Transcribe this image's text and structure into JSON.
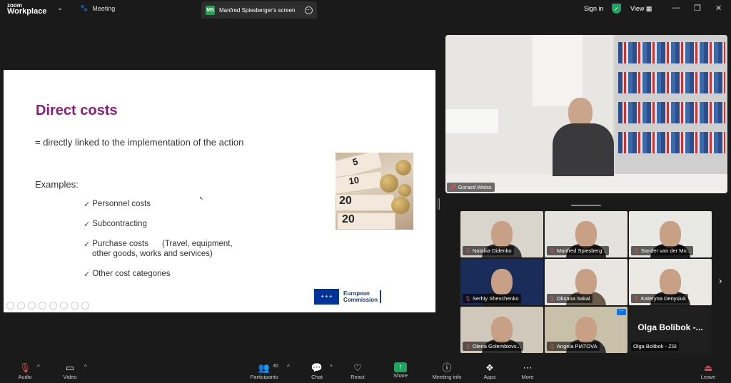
{
  "app": {
    "logo_line1": "zoom",
    "logo_line2": "Workplace"
  },
  "tabs": {
    "meeting": "Meeting",
    "screen": "Manfred Spiesberger's screen",
    "screen_badge": "MS"
  },
  "topright": {
    "signin": "Sign in",
    "view": "View"
  },
  "slide": {
    "title": "Direct costs",
    "subtitle": "= directly linked to the implementation of the action",
    "examples_label": "Examples:",
    "bullets": [
      "Personnel costs",
      "Subcontracting",
      "Purchase costs      (Travel, equipment,",
      "other goods, works and services)",
      "Other cost categories"
    ],
    "logo_line1": "European",
    "logo_line2": "Commission"
  },
  "speaker": {
    "name": "Gorazd Weiss"
  },
  "gallery": [
    {
      "name": "Nataliia Didenko",
      "bg": "#d9d4cc",
      "shirt": "#3b3b3b"
    },
    {
      "name": "Manfred Spiesberg...",
      "bg": "#e4e2dc",
      "shirt": "#2b2b2b"
    },
    {
      "name": "Sander van der Mo...",
      "bg": "#e8e8e4",
      "shirt": "#1e1e22"
    },
    {
      "name": "Serhiy Shevchenko",
      "bg": "#1a2c5a",
      "shirt": "#222"
    },
    {
      "name": "Oksana Sakal",
      "bg": "#e9e6e1",
      "shirt": "#6a5a4a"
    },
    {
      "name": "Kateryna Denysiuk",
      "bg": "#ebe9e3",
      "shirt": "#2b2b2b"
    },
    {
      "name": "Olena Golembiovs...",
      "bg": "#cfc8bb",
      "shirt": "#2f2f2f"
    },
    {
      "name": "Angela PIATOVA",
      "bg": "#c8c0a8",
      "shirt": "#333"
    },
    {
      "name": "Olga Bolibok - ZSI",
      "bg": "#1f1f1f",
      "shirt": "none",
      "display_name": "Olga Bolibok -..."
    }
  ],
  "toolbar": {
    "audio": "Audio",
    "video": "Video",
    "participants": "Participants",
    "participant_count": "30",
    "chat": "Chat",
    "react": "React",
    "share": "Share",
    "meeting_info": "Meeting info",
    "apps": "Apps",
    "more": "More",
    "leave": "Leave"
  }
}
